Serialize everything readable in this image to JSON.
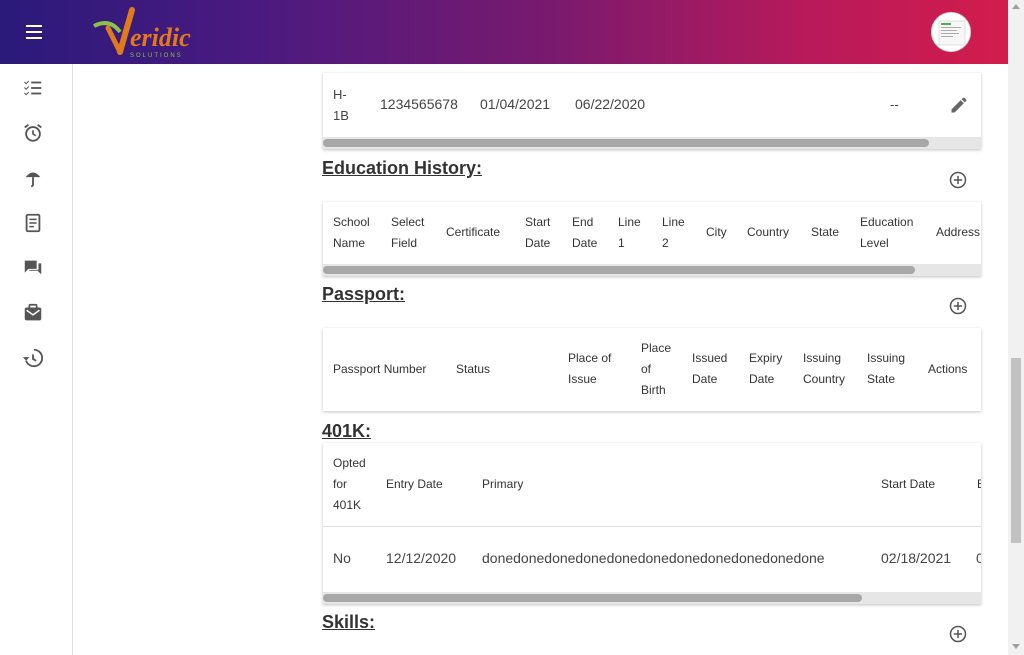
{
  "brand": {
    "logo_text": "eridic",
    "logo_initial": "V",
    "logo_sub": "SOLUTIONS"
  },
  "colors": {
    "header_start": "#2a1a7a",
    "header_end": "#d21c4d",
    "accent": "#e07a1a"
  },
  "sidebar": {
    "icons": [
      "checklist-icon",
      "alarm-clock-icon",
      "umbrella-icon",
      "document-icon",
      "chat-icon",
      "mail-briefcase-icon",
      "history-icon"
    ]
  },
  "visa": {
    "row": {
      "type": "H-\n1B",
      "number": "1234565678",
      "date1": "01/04/2021",
      "date2": "06/22/2020",
      "extra": "--"
    }
  },
  "education": {
    "title": "Education History:",
    "headers": [
      "School\nName",
      "Select\nField",
      "Certificate",
      "Start\nDate",
      "End\nDate",
      "Line\n1",
      "Line\n2",
      "City",
      "Country",
      "State",
      "Education\nLevel",
      "Address"
    ]
  },
  "passport": {
    "title": "Passport:",
    "headers": [
      "Passport Number",
      "Status",
      "Place of\nIssue",
      "Place\nof\nBirth",
      "Issued\nDate",
      "Expiry\nDate",
      "Issuing\nCountry",
      "Issuing\nState",
      "Actions"
    ]
  },
  "k401": {
    "title": "401K:",
    "headers": [
      "Opted\nfor\n401K",
      "Entry Date",
      "Primary",
      "Start Date",
      "E"
    ],
    "row": {
      "opted": "No",
      "entry_date": "12/12/2020",
      "primary": "donedonedonedonedonedonedonedonedonedonedone",
      "start_date": "02/18/2021",
      "extra": "0"
    }
  },
  "skills": {
    "title": "Skills:"
  }
}
